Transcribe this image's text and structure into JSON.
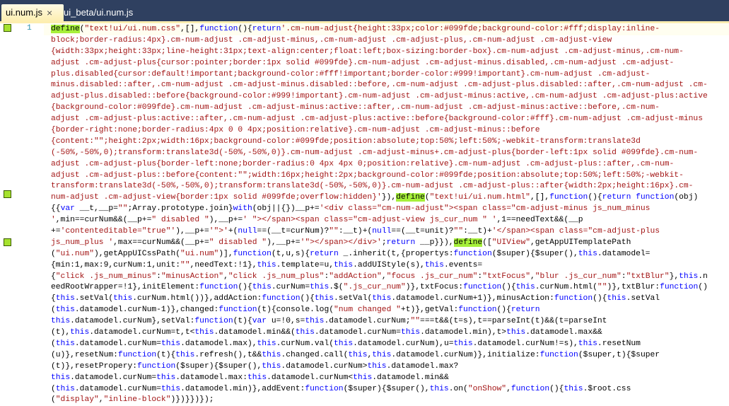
{
  "tabs": [
    {
      "label": "ui.num.js",
      "active": true,
      "close": "×"
    },
    {
      "label": "ui_beta/ui.num.js",
      "active": false
    }
  ],
  "editor": {
    "line_number": "1",
    "colors": {
      "string": "#a31515",
      "keyword": "#0000ff",
      "highlight": "#a6f03a",
      "line_number": "#2b91af"
    },
    "lines": [
      [
        [
          "define",
          "d"
        ],
        [
          "(",
          "p"
        ],
        [
          "\"text!ui/ui.num.css\"",
          "s"
        ],
        [
          ",[],",
          "p"
        ],
        [
          "function",
          "k"
        ],
        [
          "(){",
          "p"
        ],
        [
          "return",
          "k"
        ],
        [
          "'.cm-num-adjust{height:33px;color:#099fde;background-color:#fff;display:inline-",
          "s"
        ]
      ],
      [
        [
          "block;border-radius:4px}.cm-num-adjust .cm-adjust-minus,.cm-num-adjust .cm-adjust-plus,.cm-num-adjust .cm-adjust-view",
          "s"
        ]
      ],
      [
        [
          "{width:33px;height:33px;line-height:31px;text-align:center;float:left;box-sizing:border-box}.cm-num-adjust .cm-adjust-minus,.cm-num-",
          "s"
        ]
      ],
      [
        [
          "adjust .cm-adjust-plus{cursor:pointer;border:1px solid #099fde}.cm-num-adjust .cm-adjust-minus.disabled,.cm-num-adjust .cm-adjust-",
          "s"
        ]
      ],
      [
        [
          "plus.disabled{cursor:default!important;background-color:#fff!important;border-color:#999!important}.cm-num-adjust .cm-adjust-",
          "s"
        ]
      ],
      [
        [
          "minus.disabled::after,.cm-num-adjust .cm-adjust-minus.disabled::before,.cm-num-adjust .cm-adjust-plus.disabled::after,.cm-num-adjust .cm-",
          "s"
        ]
      ],
      [
        [
          "adjust-plus.disabled::before{background-color:#999!important}.cm-num-adjust .cm-adjust-minus:active,.cm-num-adjust .cm-adjust-plus:active",
          "s"
        ]
      ],
      [
        [
          "{background-color:#099fde}.cm-num-adjust .cm-adjust-minus:active::after,.cm-num-adjust .cm-adjust-minus:active::before,.cm-num-",
          "s"
        ]
      ],
      [
        [
          "adjust .cm-adjust-plus:active::after,.cm-num-adjust .cm-adjust-plus:active::before{background-color:#fff}.cm-num-adjust .cm-adjust-minus",
          "s"
        ]
      ],
      [
        [
          "{border-right:none;border-radius:4px 0 0 4px;position:relative}.cm-num-adjust .cm-adjust-minus::before",
          "s"
        ]
      ],
      [
        [
          "{content:\"\";height:2px;width:16px;background-color:#099fde;position:absolute;top:50%;left:50%;-webkit-transform:translate3d",
          "s"
        ]
      ],
      [
        [
          "(-50%,-50%,0);transform:translate3d(-50%,-50%,0)}.cm-num-adjust .cm-adjust-minus+.cm-adjust-plus{border-left:1px solid #099fde}.cm-num-",
          "s"
        ]
      ],
      [
        [
          "adjust .cm-adjust-plus{border-left:none;border-radius:0 4px 4px 0;position:relative}.cm-num-adjust .cm-adjust-plus::after,.cm-num-",
          "s"
        ]
      ],
      [
        [
          "adjust .cm-adjust-plus::before{content:\"\";width:16px;height:2px;background-color:#099fde;position:absolute;top:50%;left:50%;-webkit-",
          "s"
        ]
      ],
      [
        [
          "transform:translate3d(-50%,-50%,0);transform:translate3d(-50%,-50%,0)}.cm-num-adjust .cm-adjust-plus::after{width:2px;height:16px}.cm-",
          "s"
        ]
      ],
      [
        [
          "num-adjust .cm-adjust-view{border:1px solid #099fde;overflow:hidden}'",
          "s"
        ],
        [
          "}),",
          "p"
        ],
        [
          "define",
          "d"
        ],
        [
          "(",
          "p"
        ],
        [
          "\"text!ui/ui.num.html\"",
          "s"
        ],
        [
          ",[],",
          "p"
        ],
        [
          "function",
          "k"
        ],
        [
          "(){",
          "p"
        ],
        [
          "return function",
          "k"
        ],
        [
          "(obj)",
          "p"
        ]
      ],
      [
        [
          "{{",
          "p"
        ],
        [
          "var",
          "k"
        ],
        [
          " __t,__p=",
          "p"
        ],
        [
          "\"\"",
          "s"
        ],
        [
          ";Array.prototype.join}",
          "p"
        ],
        [
          "with",
          "k"
        ],
        [
          "(obj||{})__p+=",
          "p"
        ],
        [
          "'<div class=\"cm-num-adjust\"><span class=\"cm-adjust-minus js_num_minus",
          "s"
        ]
      ],
      [
        [
          "'",
          "s"
        ],
        [
          ",min==curNum&&(__p+=",
          "p"
        ],
        [
          "\" disabled \"",
          "s"
        ],
        [
          "),__p+=",
          "p"
        ],
        [
          "' \"></span><span class=\"cm-adjust-view js_cur_num \" '",
          "s"
        ],
        [
          ",1==needText&&(__p",
          "p"
        ]
      ],
      [
        [
          "+=",
          "p"
        ],
        [
          "'contenteditable=\"true\"'",
          "s"
        ],
        [
          "),__p+=",
          "p"
        ],
        [
          "'\">'",
          "s"
        ],
        [
          "+(",
          "p"
        ],
        [
          "null",
          "k"
        ],
        [
          "==(__t=curNum)?",
          "p"
        ],
        [
          "\"\"",
          "s"
        ],
        [
          ":__t)+(",
          "p"
        ],
        [
          "null",
          "k"
        ],
        [
          "==(__t=unit)?",
          "p"
        ],
        [
          "\"\"",
          "s"
        ],
        [
          ":__t)+",
          "p"
        ],
        [
          "'</span><span class=\"cm-adjust-plus",
          "s"
        ]
      ],
      [
        [
          "js_num_plus '",
          "s"
        ],
        [
          ",max==curNum&&(__p+=",
          "p"
        ],
        [
          "\" disabled \"",
          "s"
        ],
        [
          "),__p+=",
          "p"
        ],
        [
          "'\"></span></div>'",
          "s"
        ],
        [
          ";",
          "p"
        ],
        [
          "return",
          "k"
        ],
        [
          " __p}}),",
          "p"
        ],
        [
          "define",
          "d"
        ],
        [
          "([",
          "p"
        ],
        [
          "\"UIView\"",
          "s"
        ],
        [
          ",getAppUITemplatePath",
          "p"
        ]
      ],
      [
        [
          "(",
          "p"
        ],
        [
          "\"ui.num\"",
          "s"
        ],
        [
          "),getAppUICssPath(",
          "p"
        ],
        [
          "\"ui.num\"",
          "s"
        ],
        [
          ")],",
          "p"
        ],
        [
          "function",
          "k"
        ],
        [
          "(t,u,s){",
          "p"
        ],
        [
          "return",
          "k"
        ],
        [
          " _.inherit(t,{propertys:",
          "p"
        ],
        [
          "function",
          "k"
        ],
        [
          "($super){$super(),",
          "p"
        ],
        [
          "this",
          "k"
        ],
        [
          ".datamodel=",
          "p"
        ]
      ],
      [
        [
          "{min:1,max:9,curNum:1,unit:",
          "p"
        ],
        [
          "\"\"",
          "s"
        ],
        [
          ",needText:!1},",
          "p"
        ],
        [
          "this",
          "k"
        ],
        [
          ".template=u,",
          "p"
        ],
        [
          "this",
          "k"
        ],
        [
          ".addUIStyle(s),",
          "p"
        ],
        [
          "this",
          "k"
        ],
        [
          ".events=",
          "p"
        ]
      ],
      [
        [
          "{",
          "p"
        ],
        [
          "\"click .js_num_minus\"",
          "s"
        ],
        [
          ":",
          "p"
        ],
        [
          "\"minusAction\"",
          "s"
        ],
        [
          ",",
          "p"
        ],
        [
          "\"click .js_num_plus\"",
          "s"
        ],
        [
          ":",
          "p"
        ],
        [
          "\"addAction\"",
          "s"
        ],
        [
          ",",
          "p"
        ],
        [
          "\"focus .js_cur_num\"",
          "s"
        ],
        [
          ":",
          "p"
        ],
        [
          "\"txtFocus\"",
          "s"
        ],
        [
          ",",
          "p"
        ],
        [
          "\"blur .js_cur_num\"",
          "s"
        ],
        [
          ":",
          "p"
        ],
        [
          "\"txtBlur\"",
          "s"
        ],
        [
          "},",
          "p"
        ],
        [
          "this",
          "k"
        ],
        [
          ".n",
          "p"
        ]
      ],
      [
        [
          "eedRootWrapper=!1},initElement:",
          "p"
        ],
        [
          "function",
          "k"
        ],
        [
          "(){",
          "p"
        ],
        [
          "this",
          "k"
        ],
        [
          ".curNum=",
          "p"
        ],
        [
          "this",
          "k"
        ],
        [
          ".$(",
          "p"
        ],
        [
          "\".js_cur_num\"",
          "s"
        ],
        [
          ")},txtFocus:",
          "p"
        ],
        [
          "function",
          "k"
        ],
        [
          "(){",
          "p"
        ],
        [
          "this",
          "k"
        ],
        [
          ".curNum.html(",
          "p"
        ],
        [
          "\"\"",
          "s"
        ],
        [
          ")},txtBlur:",
          "p"
        ],
        [
          "function",
          "k"
        ],
        [
          "()",
          "p"
        ]
      ],
      [
        [
          "{",
          "p"
        ],
        [
          "this",
          "k"
        ],
        [
          ".setVal(",
          "p"
        ],
        [
          "this",
          "k"
        ],
        [
          ".curNum.html())},addAction:",
          "p"
        ],
        [
          "function",
          "k"
        ],
        [
          "(){",
          "p"
        ],
        [
          "this",
          "k"
        ],
        [
          ".setVal(",
          "p"
        ],
        [
          "this",
          "k"
        ],
        [
          ".datamodel.curNum+1)},minusAction:",
          "p"
        ],
        [
          "function",
          "k"
        ],
        [
          "(){",
          "p"
        ],
        [
          "this",
          "k"
        ],
        [
          ".setVal",
          "p"
        ]
      ],
      [
        [
          "(",
          "p"
        ],
        [
          "this",
          "k"
        ],
        [
          ".datamodel.curNum-1)},changed:",
          "p"
        ],
        [
          "function",
          "k"
        ],
        [
          "(t){console.log(",
          "p"
        ],
        [
          "\"num changed \"",
          "s"
        ],
        [
          "+t)},getVal:",
          "p"
        ],
        [
          "function",
          "k"
        ],
        [
          "(){",
          "p"
        ],
        [
          "return",
          "k"
        ]
      ],
      [
        [
          "this",
          "k"
        ],
        [
          ".datamodel.curNum},setVal:",
          "p"
        ],
        [
          "function",
          "k"
        ],
        [
          "(t){",
          "p"
        ],
        [
          "var",
          "k"
        ],
        [
          " u=!0,s=",
          "p"
        ],
        [
          "this",
          "k"
        ],
        [
          ".datamodel.curNum;",
          "p"
        ],
        [
          "\"\"",
          "s"
        ],
        [
          "===t&&(t=s),t==parseInt(t)&&(t=parseInt",
          "p"
        ]
      ],
      [
        [
          "(t),",
          "p"
        ],
        [
          "this",
          "k"
        ],
        [
          ".datamodel.curNum=t,t<",
          "p"
        ],
        [
          "this",
          "k"
        ],
        [
          ".datamodel.min&&(",
          "p"
        ],
        [
          "this",
          "k"
        ],
        [
          ".datamodel.curNum=",
          "p"
        ],
        [
          "this",
          "k"
        ],
        [
          ".datamodel.min),t>",
          "p"
        ],
        [
          "this",
          "k"
        ],
        [
          ".datamodel.max&&",
          "p"
        ]
      ],
      [
        [
          "(",
          "p"
        ],
        [
          "this",
          "k"
        ],
        [
          ".datamodel.curNum=",
          "p"
        ],
        [
          "this",
          "k"
        ],
        [
          ".datamodel.max),",
          "p"
        ],
        [
          "this",
          "k"
        ],
        [
          ".curNum.val(",
          "p"
        ],
        [
          "this",
          "k"
        ],
        [
          ".datamodel.curNum),u=",
          "p"
        ],
        [
          "this",
          "k"
        ],
        [
          ".datamodel.curNum!=s),",
          "p"
        ],
        [
          "this",
          "k"
        ],
        [
          ".resetNum",
          "p"
        ]
      ],
      [
        [
          "(u)},resetNum:",
          "p"
        ],
        [
          "function",
          "k"
        ],
        [
          "(t){",
          "p"
        ],
        [
          "this",
          "k"
        ],
        [
          ".refresh(),t&&",
          "p"
        ],
        [
          "this",
          "k"
        ],
        [
          ".changed.call(",
          "p"
        ],
        [
          "this",
          "k"
        ],
        [
          ",",
          "p"
        ],
        [
          "this",
          "k"
        ],
        [
          ".datamodel.curNum)},initialize:",
          "p"
        ],
        [
          "function",
          "k"
        ],
        [
          "($super,t){$super",
          "p"
        ]
      ],
      [
        [
          "(t)},resetPropery:",
          "p"
        ],
        [
          "function",
          "k"
        ],
        [
          "($super){$super(),",
          "p"
        ],
        [
          "this",
          "k"
        ],
        [
          ".datamodel.curNum>",
          "p"
        ],
        [
          "this",
          "k"
        ],
        [
          ".datamodel.max?",
          "p"
        ]
      ],
      [
        [
          "this",
          "k"
        ],
        [
          ".datamodel.curNum=",
          "p"
        ],
        [
          "this",
          "k"
        ],
        [
          ".datamodel.max:",
          "p"
        ],
        [
          "this",
          "k"
        ],
        [
          ".datamodel.curNum<",
          "p"
        ],
        [
          "this",
          "k"
        ],
        [
          ".datamodel.min&&",
          "p"
        ]
      ],
      [
        [
          "(",
          "p"
        ],
        [
          "this",
          "k"
        ],
        [
          ".datamodel.curNum=",
          "p"
        ],
        [
          "this",
          "k"
        ],
        [
          ".datamodel.min)},addEvent:",
          "p"
        ],
        [
          "function",
          "k"
        ],
        [
          "($super){$super(),",
          "p"
        ],
        [
          "this",
          "k"
        ],
        [
          ".on(",
          "p"
        ],
        [
          "\"onShow\"",
          "s"
        ],
        [
          ",",
          "p"
        ],
        [
          "function",
          "k"
        ],
        [
          "(){",
          "p"
        ],
        [
          "this",
          "k"
        ],
        [
          ".$root.css",
          "p"
        ]
      ],
      [
        [
          "(",
          "p"
        ],
        [
          "\"display\"",
          "s"
        ],
        [
          ",",
          "p"
        ],
        [
          "\"inline-block\"",
          "s"
        ],
        [
          ")})}})});",
          "p"
        ]
      ]
    ]
  }
}
